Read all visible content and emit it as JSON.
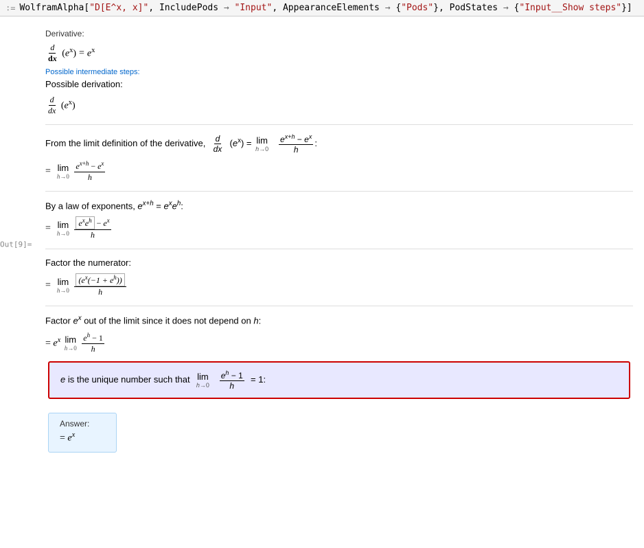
{
  "topbar": {
    "prompt": ":=",
    "code": "WolframAlpha[\"D[E^x, x]\", IncludePods → \"Input\", AppearanceElements → {\"Pods\"}, PodStates → {\"Input__Show steps\"}]"
  },
  "output_label": "Out[9]=",
  "sections": {
    "derivative_label": "Derivative:",
    "derivative_result": "d/dx (eˣ) = eˣ",
    "possible_steps_link": "Possible intermediate steps:",
    "possible_derivation": "Possible derivation:",
    "step1_text": "From the limit definition of the derivative,",
    "step2_text": "By a law of exponents, e^(x+h) = eˣ eʰ:",
    "step3_text": "Factor the numerator:",
    "step4_text_pre": "Factor",
    "step4_text_mid": "eˣ",
    "step4_text_post": "out of the limit since it does not depend on h:",
    "highlighted_text_pre": "e is the unique number such that",
    "highlighted_text_post": "= 1:",
    "answer_label": "Answer:",
    "answer_result": "= eˣ"
  }
}
